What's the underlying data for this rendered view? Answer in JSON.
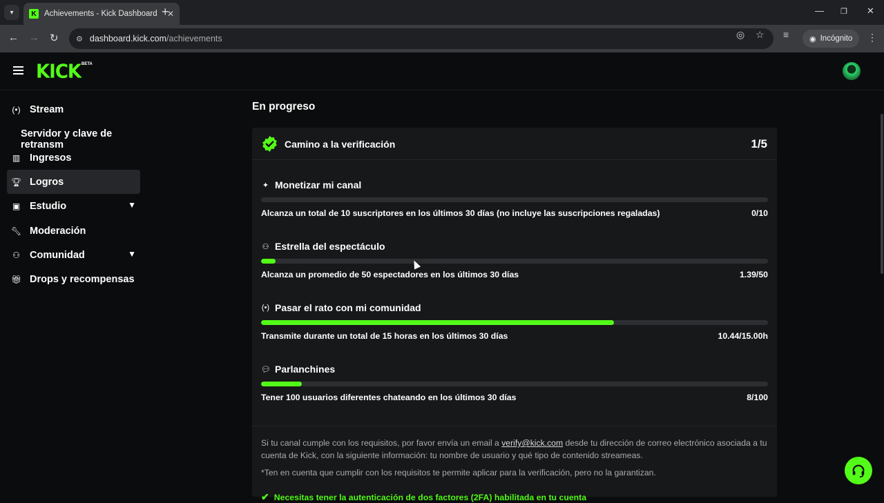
{
  "browser": {
    "tab_title": "Achievements - Kick Dashboard",
    "favicon_letter": "K",
    "url_host": "dashboard.kick.com",
    "url_path": "/achievements",
    "incognito_label": "Incógnito"
  },
  "header": {
    "logo_text": "KICK",
    "logo_badge": "BETA"
  },
  "sidebar": {
    "items": [
      {
        "label": "Stream",
        "icon": "broadcast-icon"
      },
      {
        "label": "Servidor y clave de retransm"
      },
      {
        "label": "Ingresos",
        "icon": "chart-icon"
      },
      {
        "label": "Logros",
        "icon": "trophy-icon",
        "active": true
      },
      {
        "label": "Estudio",
        "icon": "studio-icon",
        "expandable": true
      },
      {
        "label": "Moderación",
        "icon": "wrench-icon"
      },
      {
        "label": "Comunidad",
        "icon": "community-icon",
        "expandable": true
      },
      {
        "label": "Drops y recompensas",
        "icon": "gift-icon"
      }
    ]
  },
  "main": {
    "section_title": "En progreso",
    "card": {
      "title": "Camino a la verificación",
      "count": "1/5",
      "achievements": [
        {
          "name": "Monetizar mi canal",
          "icon": "sparkle-icon",
          "description": "Alcanza un total de 10 suscriptores en los últimos 30 días (no incluye las suscripciones regaladas)",
          "value": "0/10",
          "progress": 0.0
        },
        {
          "name": "Estrella del espectáculo",
          "icon": "viewers-icon",
          "description": "Alcanza un promedio de 50 espectadores en los últimos 30 días",
          "value": "1.39/50",
          "progress": 0.028
        },
        {
          "name": "Pasar el rato con mi comunidad",
          "icon": "broadcast-icon",
          "description": "Transmite durante un total de 15 horas en los últimos 30 días",
          "value": "10.44/15.00h",
          "progress": 0.696
        },
        {
          "name": "Parlanchines",
          "icon": "chat-icon",
          "description": "Tener 100 usuarios diferentes chateando en los últimos 30 días",
          "value": "8/100",
          "progress": 0.08
        }
      ],
      "footer": {
        "note_before": "Si tu canal cumple con los requisitos, por favor envía un email a ",
        "email": "verify@kick.com",
        "note_after": " desde tu dirección de correo electrónico asociada a tu cuenta de Kick, con la siguiente información: tu nombre de usuario y qué tipo de contenido streameas.",
        "disclaimer": "*Ten en cuenta que cumplir con los requisitos te permite aplicar para la verificación, pero no la garantizan.",
        "requirement": "Necesitas tener la autenticación de dos factores (2FA) habilitada en tu cuenta"
      }
    }
  },
  "colors": {
    "accent": "#53fc18",
    "background": "#0b0c0d",
    "card": "#17181a",
    "track": "#2d2e31"
  }
}
